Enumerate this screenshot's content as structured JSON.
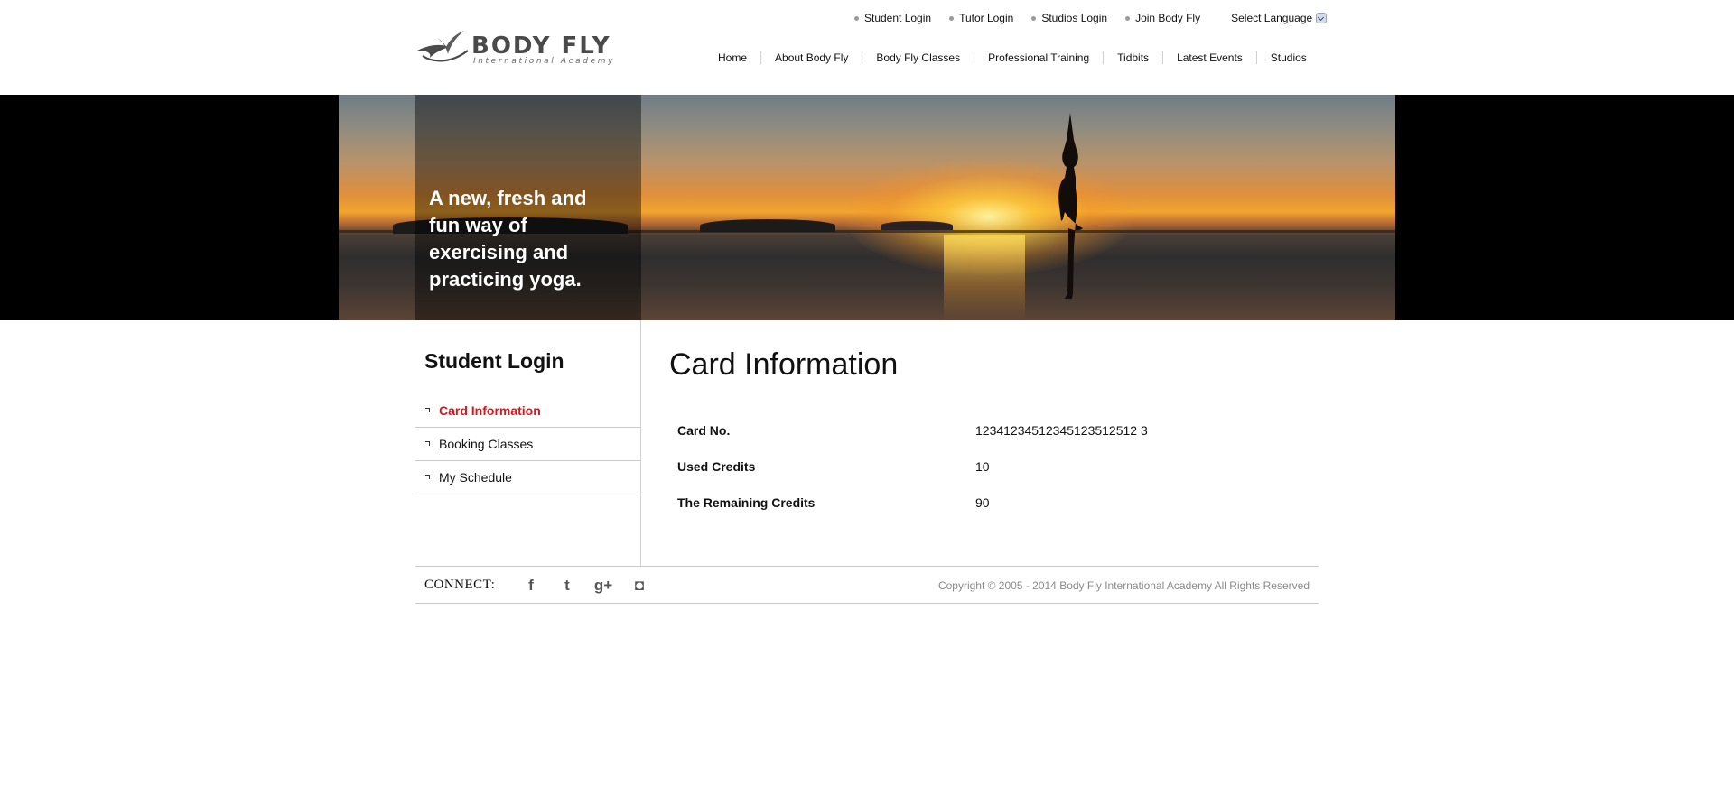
{
  "logo": {
    "name": "BODY FLY",
    "tagline": "International Academy"
  },
  "toplinks": [
    {
      "label": "Student Login"
    },
    {
      "label": "Tutor Login"
    },
    {
      "label": "Studios Login"
    },
    {
      "label": "Join Body Fly"
    }
  ],
  "language": {
    "label": "Select Language"
  },
  "nav": [
    {
      "label": "Home"
    },
    {
      "label": "About Body Fly"
    },
    {
      "label": "Body Fly Classes"
    },
    {
      "label": "Professional Training"
    },
    {
      "label": "Tidbits"
    },
    {
      "label": "Latest Events"
    },
    {
      "label": "Studios"
    }
  ],
  "banner": {
    "lines": [
      "A new, fresh and",
      "fun way of",
      "exercising and",
      "practicing yoga."
    ]
  },
  "sidebar": {
    "title": "Student Login",
    "items": [
      {
        "label": "Card Information",
        "active": true
      },
      {
        "label": "Booking Classes",
        "active": false
      },
      {
        "label": "My Schedule",
        "active": false
      }
    ]
  },
  "main": {
    "title": "Card Information",
    "rows": [
      {
        "label": "Card No.",
        "value": "12341234512345123512512 3"
      },
      {
        "label": "Used Credits",
        "value": "10"
      },
      {
        "label": "The Remaining Credits",
        "value": "90"
      }
    ]
  },
  "footer": {
    "connect_label": "CONNECT:",
    "social": [
      {
        "icon": "facebook-icon",
        "glyph": "f"
      },
      {
        "icon": "twitter-icon",
        "glyph": "t"
      },
      {
        "icon": "google-plus-icon",
        "glyph": "g+"
      },
      {
        "icon": "instagram-icon",
        "glyph": "◘"
      }
    ],
    "copyright": "Copyright © 2005 - 2014 Body Fly International Academy All Rights Reserved"
  },
  "colors": {
    "accent": "#d8161b",
    "text": "#111111",
    "muted": "#8a8a8a",
    "divider": "#c9c9c9"
  }
}
